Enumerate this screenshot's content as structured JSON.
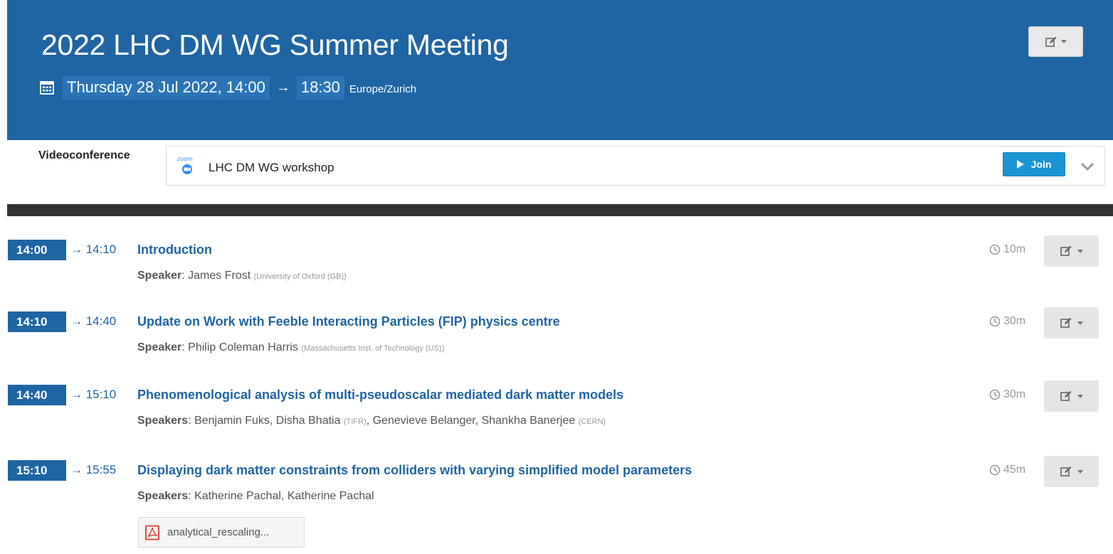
{
  "event": {
    "title": "2022 LHC DM WG Summer Meeting",
    "start_datetime": "Thursday 28 Jul 2022, 14:00",
    "arrow": "→",
    "end_time": "18:30",
    "timezone": "Europe/Zurich"
  },
  "videoconference": {
    "label": "Videoconference",
    "provider_icon": "zoom-logo-icon",
    "name": "LHC DM WG workshop",
    "join_label": "Join"
  },
  "timetable": [
    {
      "start": "14:00",
      "end": "→ 14:10",
      "title": "Introduction",
      "speaker_label": "Speaker",
      "speakers_text": ": James Frost",
      "affiliation": "(University of Oxford (GB))",
      "duration": "10m"
    },
    {
      "start": "14:10",
      "end": "→ 14:40",
      "title": "Update on Work with Feeble Interacting Particles (FIP) physics centre",
      "speaker_label": "Speaker",
      "speakers_text": ": Philip Coleman Harris",
      "affiliation": "(Massachusetts Inst. of Technology (US))",
      "duration": "30m"
    },
    {
      "start": "14:40",
      "end": "→ 15:10",
      "title": "Phenomenological analysis of multi-pseudoscalar mediated dark matter models",
      "speaker_label": "Speakers",
      "speakers_parts": [
        ": Benjamin Fuks, Disha Bhatia ",
        "(TIFR)",
        ", Genevieve Belanger, Shankha Banerjee ",
        "(CERN)"
      ],
      "duration": "30m"
    },
    {
      "start": "15:10",
      "end": "→ 15:55",
      "title": "Displaying dark matter constraints from colliders with varying simplified model parameters",
      "speaker_label": "Speakers",
      "speakers_text": ": Katherine Pachal, Katherine Pachal",
      "duration": "45m",
      "attachment": "analytical_rescaling..."
    }
  ],
  "colors": {
    "header_bg": "#1f65a3",
    "date_chip_bg": "#2a74b6",
    "join_bg": "#1a95d3",
    "link_blue": "#1f65a3",
    "dark_bar": "#333333"
  }
}
